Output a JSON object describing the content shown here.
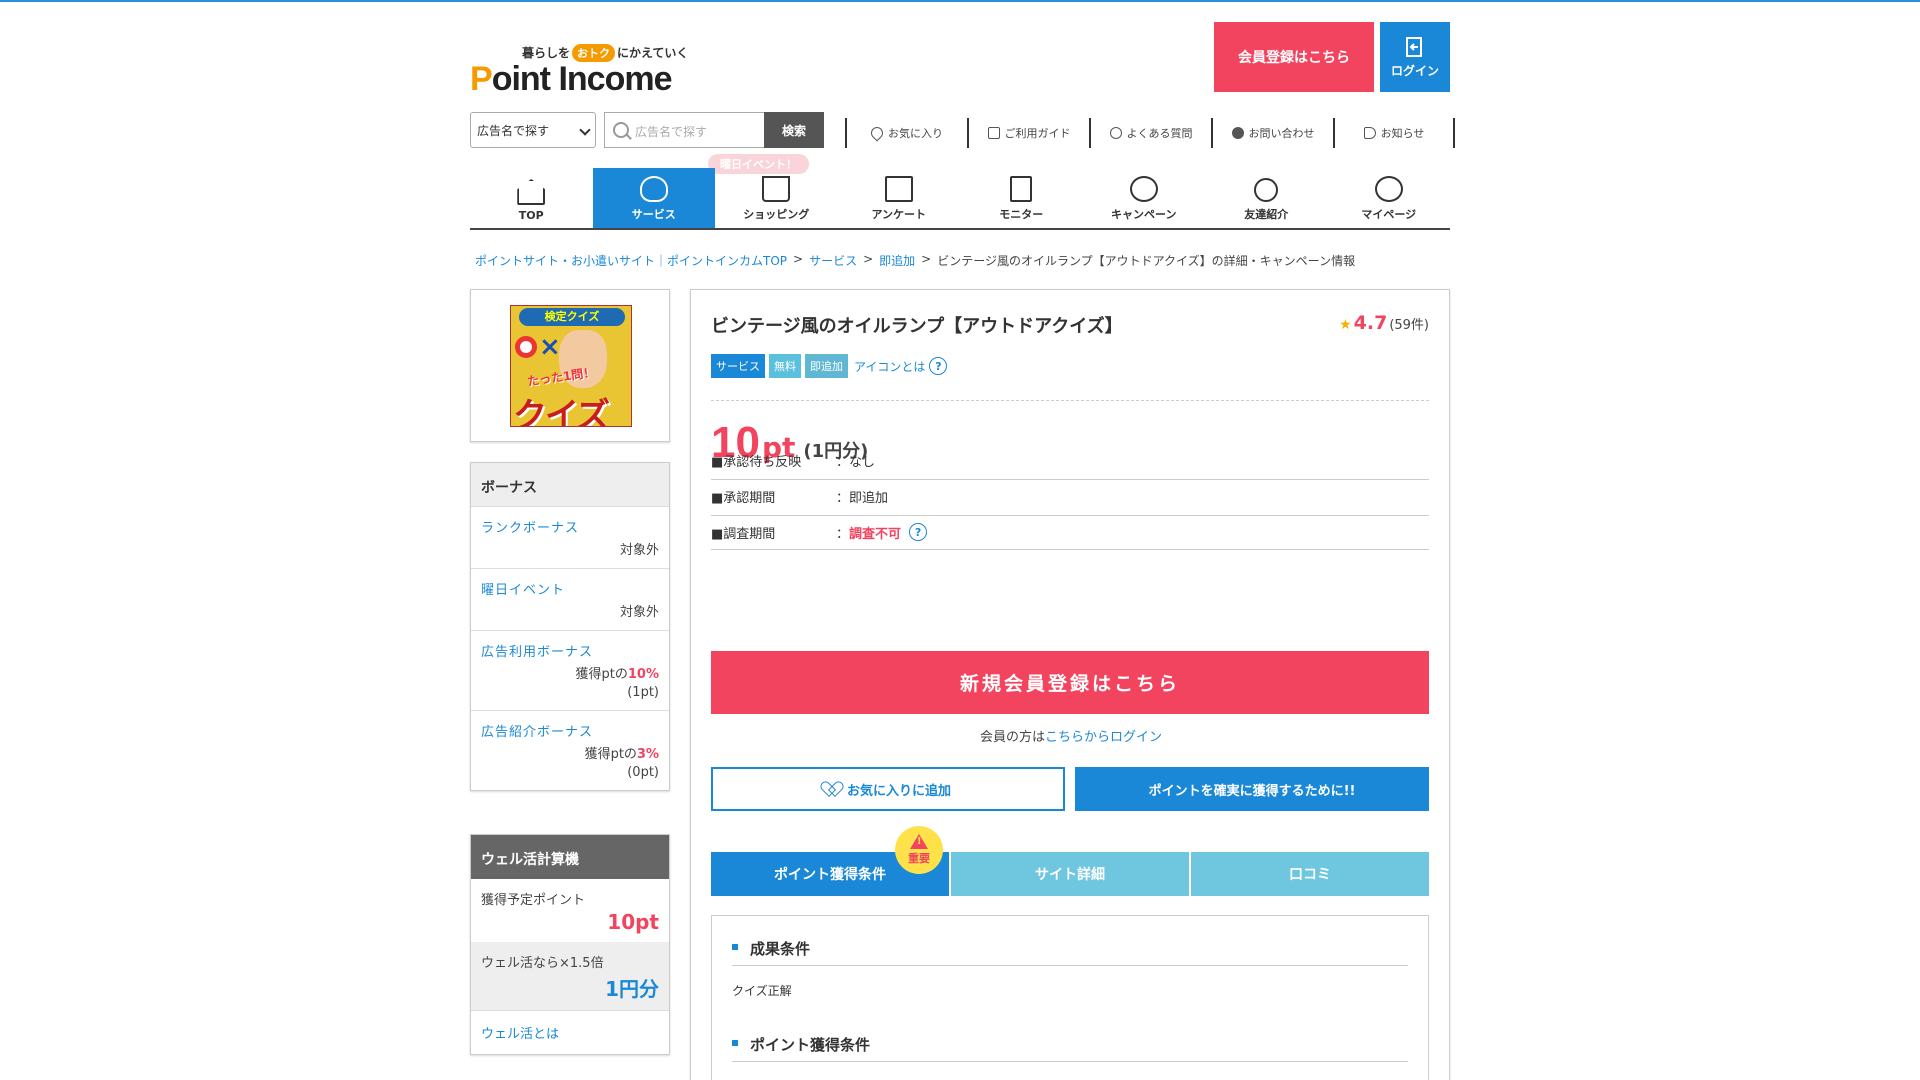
{
  "header": {
    "tagline_before": "暮らしを",
    "tagline_badge": "おトク",
    "tagline_after": "にかえていく",
    "brand_p": "P",
    "brand_rest": "oint Income",
    "register_label": "会員登録はこちら",
    "login_label": "ログイン"
  },
  "search": {
    "select_value": "広告名で探す",
    "placeholder": "広告名で探す",
    "button_label": "検索"
  },
  "util_links": [
    {
      "label": "お気に入り",
      "icon": "heart-icon"
    },
    {
      "label": "ご利用ガイド",
      "icon": "guide-icon"
    },
    {
      "label": "よくある質問",
      "icon": "question-icon"
    },
    {
      "label": "お問い合わせ",
      "icon": "chat-icon"
    },
    {
      "label": "お知らせ",
      "icon": "megaphone-icon"
    }
  ],
  "event_pill": "曜日イベント！",
  "nav": [
    {
      "label": "TOP",
      "icon": "home-icon"
    },
    {
      "label": "サービス",
      "icon": "lightbulb-icon",
      "active": true
    },
    {
      "label": "ショッピング",
      "icon": "cart-icon"
    },
    {
      "label": "アンケート",
      "icon": "survey-icon"
    },
    {
      "label": "モニター",
      "icon": "monitor-icon"
    },
    {
      "label": "キャンペーン",
      "icon": "medal-icon"
    },
    {
      "label": "友達紹介",
      "icon": "friends-icon"
    },
    {
      "label": "マイページ",
      "icon": "mypage-icon"
    }
  ],
  "breadcrumb": {
    "items": [
      "ポイントサイト・お小遣いサイト｜ポイントインカムTOP",
      "サービス",
      "即追加"
    ],
    "separator": ">",
    "current": "ビンテージ風のオイルランプ【アウトドアクイズ】の詳細・キャンペーン情報"
  },
  "thumbnail": {
    "top_text": "検定クイズ",
    "mid_text": "たった1問！",
    "big_text": "クイズ"
  },
  "bonus": {
    "title": "ボーナス",
    "rows": [
      {
        "label": "ランクボーナス",
        "value": "対象外"
      },
      {
        "label": "曜日イベント",
        "value": "対象外"
      },
      {
        "label": "広告利用ボーナス",
        "prefix": "獲得ptの",
        "rate": "10%",
        "sub": "(1pt)"
      },
      {
        "label": "広告紹介ボーナス",
        "prefix": "獲得ptの",
        "rate": "3%",
        "sub": "(0pt)"
      }
    ]
  },
  "calc": {
    "title": "ウェル活計算機",
    "row1_label": "獲得予定ポイント",
    "row1_value": "10pt",
    "row2_label": "ウェル活なら×1.5倍",
    "row2_value": "1円分",
    "link": "ウェル活とは"
  },
  "main": {
    "title": "ビンテージ風のオイルランプ【アウトドアクイズ】",
    "rating_star": "★",
    "rating_score": "4.7",
    "rating_count": "(59件)",
    "tags": [
      "サービス",
      "無料",
      "即追加"
    ],
    "icon_help": "アイコンとは",
    "points_num": "10",
    "points_unit": "pt",
    "points_yen": "(1円分)",
    "info": [
      {
        "key": "■承認待ち反映",
        "value": "：なし"
      },
      {
        "key": "■承認期間",
        "value": "：即追加"
      },
      {
        "key": "■調査期間",
        "sep": "：",
        "value": "調査不可"
      }
    ],
    "register_label": "新規会員登録はこちら",
    "login_prefix": "会員の方は",
    "login_link": "こちらからログイン",
    "fav_label": "お気に入りに追加",
    "sure_label": "ポイントを確実に獲得するために!!",
    "tabs": [
      "ポイント獲得条件",
      "サイト詳細",
      "口コミ"
    ],
    "important_badge": "重要",
    "cond1_title": "成果条件",
    "cond1_text": "クイズ正解",
    "cond2_title": "ポイント獲得条件"
  },
  "colors": {
    "accent_blue": "#1a88d6",
    "accent_pink": "#f2445f",
    "light_blue": "#6ec6df",
    "logo_orange": "#f59b00"
  }
}
